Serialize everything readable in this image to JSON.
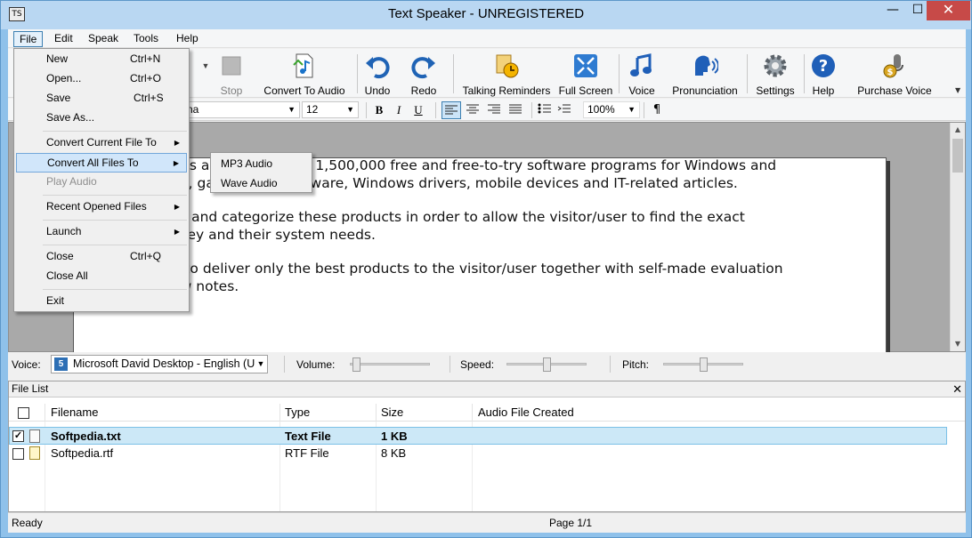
{
  "window": {
    "title": "Text Speaker - UNREGISTERED",
    "minimize": "—",
    "maximize": "☐",
    "close": "✕"
  },
  "menubar": {
    "file": "File",
    "edit": "Edit",
    "speak": "Speak",
    "tools": "Tools",
    "help": "Help"
  },
  "toolbar": {
    "stop": "Stop",
    "convert_to_audio": "Convert To Audio",
    "undo": "Undo",
    "redo": "Redo",
    "talking_reminders": "Talking Reminders",
    "full_screen": "Full Screen",
    "voice": "Voice",
    "pronunciation": "Pronunciation",
    "settings": "Settings",
    "help": "Help",
    "purchase_voice": "Purchase Voice"
  },
  "format": {
    "font_name": "na",
    "font_size": "12",
    "zoom": "100%",
    "bold": "B",
    "italic": "I",
    "underline": "U",
    "paragraph": "¶"
  },
  "document": {
    "paragraphs": [
      "Softpedia is a library of over 1,500,000 free and free-to-try software programs for Windows and Unix/Linux, games, Mac software, Windows drivers, mobile devices and IT-related articles.",
      "We review and categorize these products in order to allow the visitor/user to find the exact product they and their system needs.",
      "We strive to deliver only the best products to the visitor/user together with self-made evaluation and review notes."
    ]
  },
  "voicebar": {
    "voice_label": "Voice:",
    "voice_value": "Microsoft David Desktop - English (U",
    "volume_label": "Volume:",
    "speed_label": "Speed:",
    "pitch_label": "Pitch:",
    "volume_level": 0.02,
    "speed_level": 0.5,
    "pitch_level": 0.5
  },
  "file_list": {
    "title": "File List",
    "columns": [
      "Filename",
      "Type",
      "Size",
      "Audio File Created"
    ],
    "rows": [
      {
        "filename": "Softpedia.txt",
        "type": "Text File",
        "size": "1 KB",
        "audio": "",
        "checked": true
      },
      {
        "filename": "Softpedia.rtf",
        "type": "RTF File",
        "size": "8 KB",
        "audio": "",
        "checked": false
      }
    ]
  },
  "status": {
    "left": "Ready",
    "page": "Page 1/1"
  },
  "file_menu": {
    "new": "New",
    "new_sc": "Ctrl+N",
    "open": "Open...",
    "open_sc": "Ctrl+O",
    "save": "Save",
    "save_sc": "Ctrl+S",
    "save_as": "Save As...",
    "convert_current": "Convert Current File To",
    "convert_all": "Convert All Files To",
    "play_audio": "Play Audio",
    "recent": "Recent Opened Files",
    "launch": "Launch",
    "close": "Close",
    "close_sc": "Ctrl+Q",
    "close_all": "Close All",
    "exit": "Exit"
  },
  "submenu": {
    "mp3": "MP3 Audio",
    "wave": "Wave Audio"
  },
  "colors": {
    "accent": "#3c7fb1",
    "selected_row": "#cce8f7",
    "close_button": "#c74a48"
  }
}
